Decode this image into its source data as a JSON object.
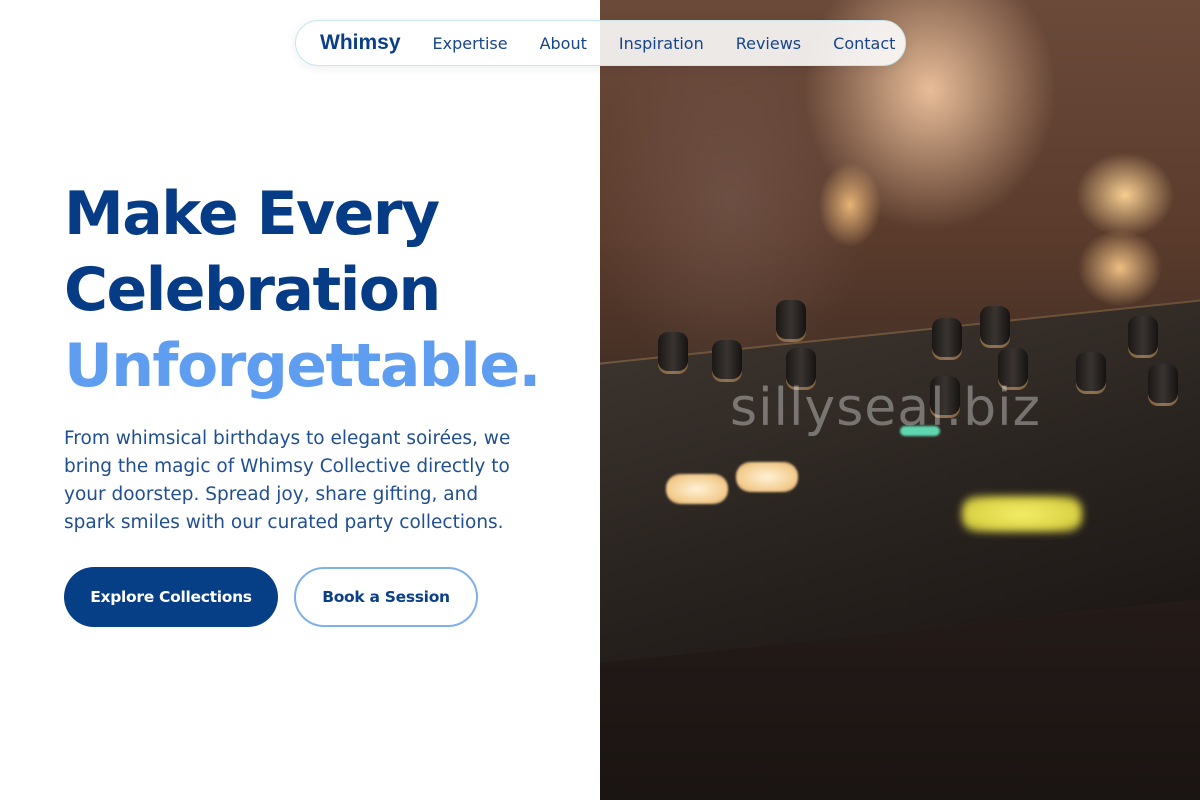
{
  "nav": {
    "brand": "Whimsy",
    "links": [
      "Expertise",
      "About",
      "Inspiration",
      "Reviews",
      "Contact"
    ]
  },
  "hero": {
    "line1": "Make Every",
    "line2": "Celebration",
    "line3": "Unforgettable.",
    "description": "From whimsical birthdays to elegant soirées, we bring the magic of Whimsy Collective directly to your doorstep. Spread joy, share gifting, and spark smiles with our curated party collections.",
    "primary_button": "Explore Collections",
    "secondary_button": "Book a Session"
  },
  "image": {
    "watermark": "sillyseal.biz",
    "subject": "dj-mixer-photo"
  },
  "colors": {
    "primary": "#063b86",
    "accent": "#5f9df0",
    "nav_border": "#c9e6ea"
  }
}
